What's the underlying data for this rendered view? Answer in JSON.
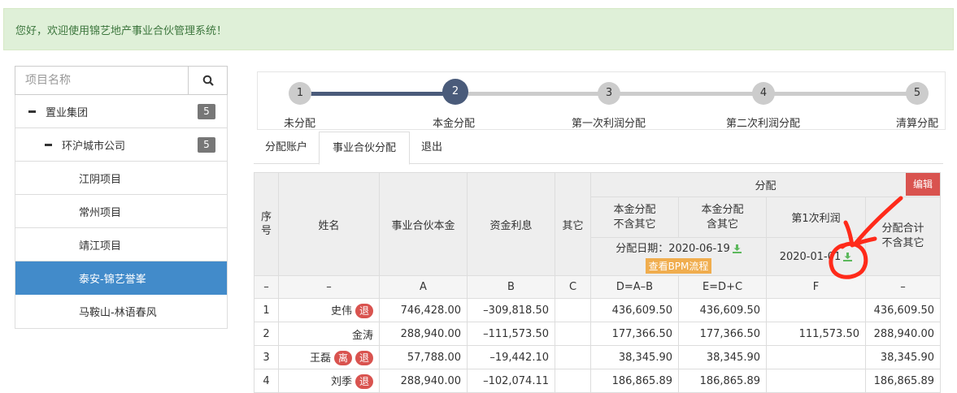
{
  "banner": {
    "text": "您好，欢迎使用锦艺地产事业合伙管理系统！"
  },
  "search": {
    "placeholder": "项目名称",
    "icon": "search-icon"
  },
  "tree": [
    {
      "label": "置业集团",
      "badge": "5",
      "level": 0
    },
    {
      "label": "环沪城市公司",
      "badge": "5",
      "level": 1
    },
    {
      "label": "江阴项目",
      "level": 2
    },
    {
      "label": "常州项目",
      "level": 2
    },
    {
      "label": "靖江项目",
      "level": 2
    },
    {
      "label": "泰安-锦艺誉峯",
      "level": 2,
      "active": true
    },
    {
      "label": "马鞍山-林语春风",
      "level": 2
    }
  ],
  "steps": [
    {
      "num": "1",
      "label": "未分配"
    },
    {
      "num": "2",
      "label": "本金分配",
      "active": true
    },
    {
      "num": "3",
      "label": "第一次利润分配"
    },
    {
      "num": "4",
      "label": "第二次利润分配"
    },
    {
      "num": "5",
      "label": "清算分配"
    }
  ],
  "tabs": [
    "分配账户",
    "事业合伙分配",
    "退出"
  ],
  "table": {
    "h_seq": "序号",
    "h_name": "姓名",
    "h_capital": "事业合伙本金",
    "h_interest": "资金利息",
    "h_other": "其它",
    "h_dist": "分配",
    "h_edit": "编辑",
    "h_d1": "本金分配\n不含其它",
    "h_d2": "本金分配\n含其它",
    "h_d3": "第1次利润",
    "h_d4": "分配合计\n不含其它",
    "dist_date": "分配日期：2020-06-19",
    "bpm": "查看BPM流程",
    "profit_date": "2020-01-01",
    "formula": [
      "–",
      "–",
      "A",
      "B",
      "C",
      "D=A–B",
      "E=D+C",
      "F",
      "–"
    ],
    "rows": [
      {
        "seq": "1",
        "name": "史伟",
        "tags": [
          "退"
        ],
        "a": "746,428.00",
        "b": "–309,818.50",
        "c": "",
        "d": "436,609.50",
        "e": "436,609.50",
        "f": "",
        "g": "436,609.50"
      },
      {
        "seq": "2",
        "name": "金涛",
        "tags": [],
        "a": "288,940.00",
        "b": "–111,573.50",
        "c": "",
        "d": "177,366.50",
        "e": "177,366.50",
        "f": "111,573.50",
        "g": "288,940.00"
      },
      {
        "seq": "3",
        "name": "王磊",
        "tags": [
          "离",
          "退"
        ],
        "a": "57,788.00",
        "b": "–19,442.10",
        "c": "",
        "d": "38,345.90",
        "e": "38,345.90",
        "f": "",
        "g": "38,345.90"
      },
      {
        "seq": "4",
        "name": "刘季",
        "tags": [
          "退"
        ],
        "a": "288,940.00",
        "b": "–102,074.11",
        "c": "",
        "d": "186,865.89",
        "e": "186,865.89",
        "f": "",
        "g": "186,865.89"
      }
    ]
  },
  "colors": {
    "accent": "#428bca",
    "step_active": "#4a5b7a",
    "danger": "#d9534f",
    "warning": "#f0ad4e",
    "success": "#5cb85c",
    "annotation": "#ff2a1a"
  }
}
